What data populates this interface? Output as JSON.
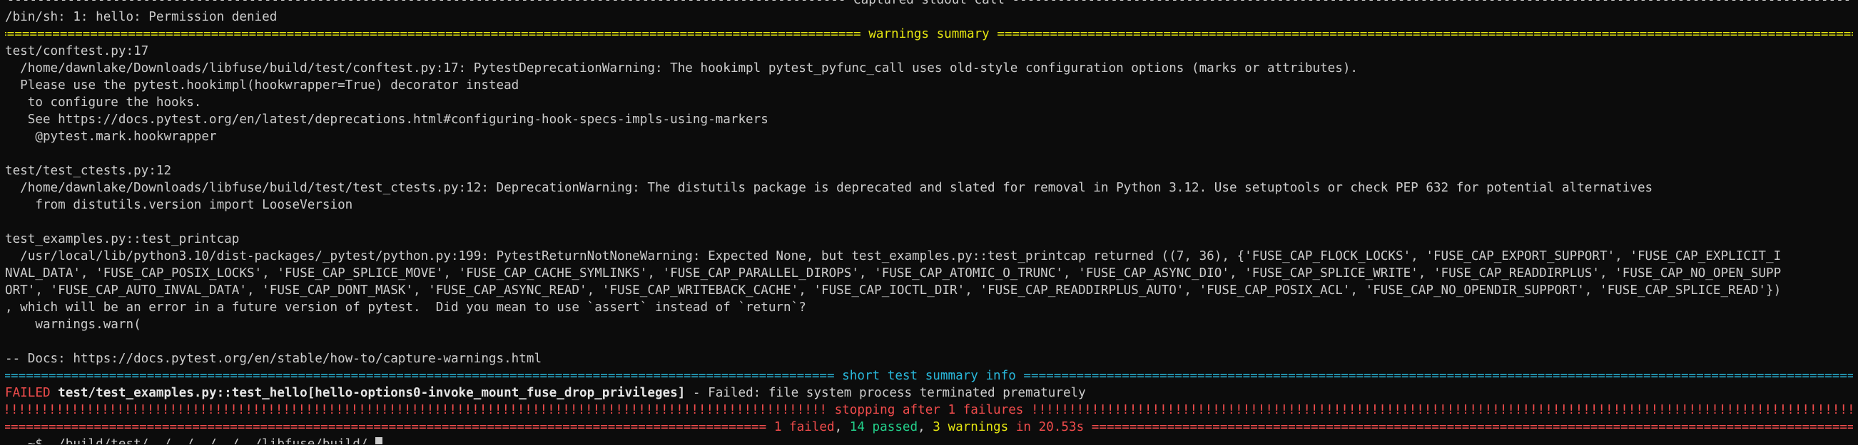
{
  "terminal": {
    "captured_header": " Captured stdout call ",
    "captured_fill_char": "-",
    "permission_line": "/bin/sh: 1: hello: Permission denied",
    "warnings_header": " warnings summary ",
    "eq_fill_char": "=",
    "block1_title": "test/conftest.py:17",
    "block1_lines": [
      "  /home/dawnlake/Downloads/libfuse/build/test/conftest.py:17: PytestDeprecationWarning: The hookimpl pytest_pyfunc_call uses old-style configuration options (marks or attributes).",
      "  Please use the pytest.hookimpl(hookwrapper=True) decorator instead",
      "   to configure the hooks.",
      "   See https://docs.pytest.org/en/latest/deprecations.html#configuring-hook-specs-impls-using-markers",
      "    @pytest.mark.hookwrapper"
    ],
    "block2_title": "test/test_ctests.py:12",
    "block2_lines": [
      "  /home/dawnlake/Downloads/libfuse/build/test/test_ctests.py:12: DeprecationWarning: The distutils package is deprecated and slated for removal in Python 3.12. Use setuptools or check PEP 632 for potential alternatives",
      "    from distutils.version import LooseVersion"
    ],
    "block3_title": "test_examples.py::test_printcap",
    "block3_lines": [
      "  /usr/local/lib/python3.10/dist-packages/_pytest/python.py:199: PytestReturnNotNoneWarning: Expected None, but test_examples.py::test_printcap returned ((7, 36), {'FUSE_CAP_FLOCK_LOCKS', 'FUSE_CAP_EXPORT_SUPPORT', 'FUSE_CAP_EXPLICIT_I",
      "NVAL_DATA', 'FUSE_CAP_POSIX_LOCKS', 'FUSE_CAP_SPLICE_MOVE', 'FUSE_CAP_CACHE_SYMLINKS', 'FUSE_CAP_PARALLEL_DIROPS', 'FUSE_CAP_ATOMIC_O_TRUNC', 'FUSE_CAP_ASYNC_DIO', 'FUSE_CAP_SPLICE_WRITE', 'FUSE_CAP_READDIRPLUS', 'FUSE_CAP_NO_OPEN_SUPP",
      "ORT', 'FUSE_CAP_AUTO_INVAL_DATA', 'FUSE_CAP_DONT_MASK', 'FUSE_CAP_ASYNC_READ', 'FUSE_CAP_WRITEBACK_CACHE', 'FUSE_CAP_IOCTL_DIR', 'FUSE_CAP_READDIRPLUS_AUTO', 'FUSE_CAP_POSIX_ACL', 'FUSE_CAP_NO_OPENDIR_SUPPORT', 'FUSE_CAP_SPLICE_READ'})",
      ", which will be an error in a future version of pytest.  Did you mean to use `assert` instead of `return`?",
      "    warnings.warn("
    ],
    "docs_line": "-- Docs: https://docs.pytest.org/en/stable/how-to/capture-warnings.html",
    "short_summary_header": " short test summary info ",
    "failed_label": "FAILED",
    "failed_test": " test/test_examples.py::test_hello[hello-options0-invoke_mount_fuse_drop_privileges]",
    "failed_reason": " - Failed: file system process terminated prematurely",
    "bang_fill_char": "!",
    "stopping_text": " stopping after 1 failures ",
    "result_failed": "1 failed",
    "result_sep1": ", ",
    "result_passed": "14 passed",
    "result_sep2": ", ",
    "result_warnings": "3 warnings",
    "result_time": " in 20.53s",
    "prompt_partial": "   ~$ ./build/test/../../../../../libfuse/build/ "
  },
  "colors": {
    "background": "#0c0c0c",
    "text": "#cccccc",
    "warning_yellow": "#e5e510",
    "info_cyan": "#29b8db",
    "fail_red": "#f14c4c",
    "pass_green": "#23d18b"
  }
}
